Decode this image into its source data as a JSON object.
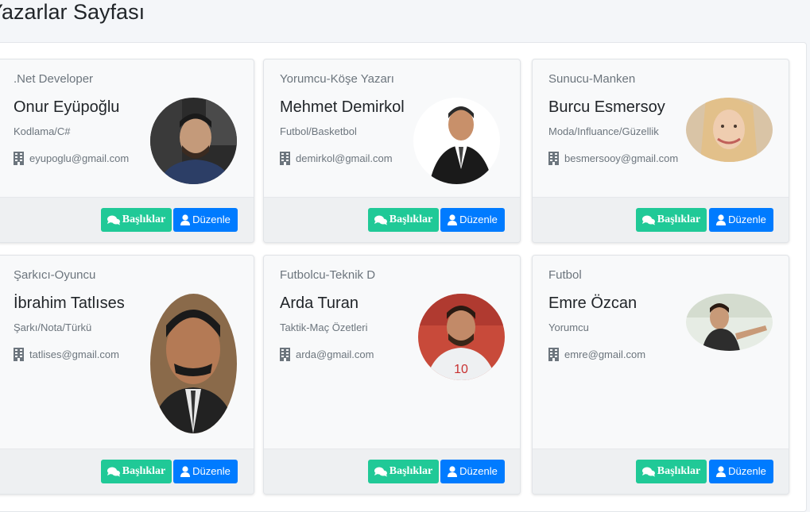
{
  "page": {
    "title": "Yazarlar Sayfası"
  },
  "buttons": {
    "titles_label": "Başlıklar",
    "edit_label": "Düzenle"
  },
  "colors": {
    "green": "#20c997",
    "blue": "#007bff"
  },
  "authors": [
    {
      "role": ".Net Developer",
      "name": "Onur Eyüpoğlu",
      "topic": "Kodlama/C#",
      "email": "eyupoglu@gmail.com"
    },
    {
      "role": "Yorumcu-Köşe Yazarı",
      "name": "Mehmet Demirkol",
      "topic": "Futbol/Basketbol",
      "email": "demirkol@gmail.com"
    },
    {
      "role": "Sunucu-Manken",
      "name": "Burcu Esmersoy",
      "topic": "Moda/Influance/Güzellik",
      "email": "besmersooy@gmail.com"
    },
    {
      "role": "Şarkıcı-Oyuncu",
      "name": "İbrahim Tatlıses",
      "topic": "Şarkı/Nota/Türkü",
      "email": "tatlises@gmail.com"
    },
    {
      "role": "Futbolcu-Teknik D",
      "name": "Arda Turan",
      "topic": "Taktik-Maç Özetleri",
      "email": "arda@gmail.com"
    },
    {
      "role": "Futbol",
      "name": "Emre Özcan",
      "topic": "Yorumcu",
      "email": "emre@gmail.com"
    }
  ]
}
